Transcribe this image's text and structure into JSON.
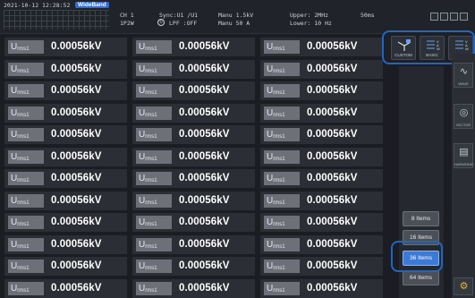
{
  "status": {
    "datetime": "2021-10-12  12:28:52",
    "mode_badge": "WideBand",
    "channel": "CH 1",
    "wiring": "1P2W",
    "sync": "Sync:U1  /U1",
    "lpf": "LPF :OFF",
    "manu_voltage": "Manu  1.5kV",
    "manu_current": "Manu  50 A",
    "upper": "Upper:  2MHz",
    "lower": "Lower:  10 Hz",
    "period": "50ms",
    "circle_glyph": "①"
  },
  "display_format": {
    "custom": "CUSTOM",
    "basic": "BASIC",
    "value": "VALUE",
    "accent": "#1e66c7"
  },
  "rows": [
    [
      {
        "label": "U",
        "sub": "rms1",
        "value": "0.00056kV"
      },
      {
        "label": "U",
        "sub": "rms1",
        "value": "0.00056kV"
      },
      {
        "label": "U",
        "sub": "rms1",
        "value": "0.00056kV"
      }
    ],
    [
      {
        "label": "U",
        "sub": "rms1",
        "value": "0.00056kV"
      },
      {
        "label": "U",
        "sub": "rms1",
        "value": "0.00056kV"
      },
      {
        "label": "U",
        "sub": "rms1",
        "value": "0.00056kV"
      }
    ],
    [
      {
        "label": "U",
        "sub": "rms1",
        "value": "0.00056kV"
      },
      {
        "label": "U",
        "sub": "rms1",
        "value": "0.00056kV"
      },
      {
        "label": "U",
        "sub": "rms1",
        "value": "0.00056kV"
      }
    ],
    [
      {
        "label": "U",
        "sub": "rms1",
        "value": "0.00056kV"
      },
      {
        "label": "U",
        "sub": "rms1",
        "value": "0.00056kV"
      },
      {
        "label": "U",
        "sub": "rms1",
        "value": "0.00056kV"
      }
    ],
    [
      {
        "label": "U",
        "sub": "rms1",
        "value": "0.00056kV"
      },
      {
        "label": "U",
        "sub": "rms1",
        "value": "0.00056kV"
      },
      {
        "label": "U",
        "sub": "rms1",
        "value": "0.00056kV"
      }
    ],
    [
      {
        "label": "U",
        "sub": "rms1",
        "value": "0.00056kV"
      },
      {
        "label": "U",
        "sub": "rms1",
        "value": "0.00056kV"
      },
      {
        "label": "U",
        "sub": "rms1",
        "value": "0.00056kV"
      }
    ],
    [
      {
        "label": "U",
        "sub": "rms1",
        "value": "0.00056kV"
      },
      {
        "label": "U",
        "sub": "rms1",
        "value": "0.00056kV"
      },
      {
        "label": "U",
        "sub": "rms1",
        "value": "0.00056kV"
      }
    ],
    [
      {
        "label": "U",
        "sub": "rms1",
        "value": "0.00056kV"
      },
      {
        "label": "U",
        "sub": "rms1",
        "value": "0.00056kV"
      },
      {
        "label": "U",
        "sub": "rms1",
        "value": "0.00056kV"
      }
    ],
    [
      {
        "label": "U",
        "sub": "rms1",
        "value": "0.00056kV"
      },
      {
        "label": "U",
        "sub": "rms1",
        "value": "0.00056kV"
      },
      {
        "label": "U",
        "sub": "rms1",
        "value": "0.00056kV"
      }
    ],
    [
      {
        "label": "U",
        "sub": "rms1",
        "value": "0.00056kV"
      },
      {
        "label": "U",
        "sub": "rms1",
        "value": "0.00056kV"
      },
      {
        "label": "U",
        "sub": "rms1",
        "value": "0.00056kV"
      }
    ],
    [
      {
        "label": "U",
        "sub": "rms1",
        "value": "0.00056kV"
      },
      {
        "label": "U",
        "sub": "rms1",
        "value": "0.00056kV"
      },
      {
        "label": "U",
        "sub": "rms1",
        "value": "0.00056kV"
      }
    ],
    [
      {
        "label": "U",
        "sub": "rms1",
        "value": "0.00056kV"
      },
      {
        "label": "U",
        "sub": "rms1",
        "value": "0.00056kV"
      },
      {
        "label": "U",
        "sub": "rms1",
        "value": "0.00056kV"
      }
    ]
  ],
  "item_count_options": [
    {
      "label": "8 Items",
      "selected": false
    },
    {
      "label": "16 Items",
      "selected": false
    },
    {
      "label": "36 Items",
      "selected": true
    },
    {
      "label": "64 Items",
      "selected": false
    }
  ],
  "rail": {
    "wave": "WAVE",
    "vector": "VECTOR",
    "harmonic": "HARMONIC"
  },
  "page_indicator_count": 4
}
